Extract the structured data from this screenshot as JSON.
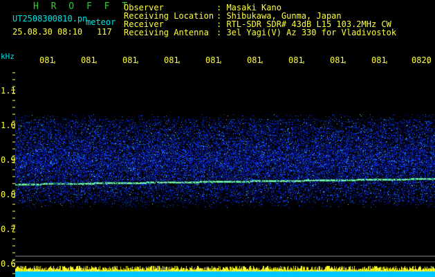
{
  "header": {
    "program": "H R O F F T",
    "filename": "UT2508300810.pn",
    "event_label": "meteor",
    "datetime": "25.08.30 08:10",
    "count": "117",
    "info_labels": [
      "Observer",
      "Receiving Location",
      "Receiver",
      "Receiving Antenna"
    ],
    "info_values": [
      ": Masaki Kano",
      ": Shibukawa, Gunma, Japan",
      ": RTL-SDR SDR# 43dB L15 103.2MHz CW",
      ": 3el Yagi(V) Az 330 for Vladivostok"
    ]
  },
  "axis": {
    "unit": "kHz",
    "y_ticks": [
      "1.1",
      "1.0",
      "0.9",
      "0.8",
      "0.7",
      "0.6"
    ],
    "x_ticks": [
      "081",
      "081",
      "081",
      "081",
      "081",
      "081",
      "081",
      "081",
      "081",
      "0820"
    ]
  },
  "colors": {
    "green": "#2fd12f",
    "cyan": "#00e6e6",
    "yellow": "#ffff3c",
    "noise_blue": "#1a3cff"
  }
}
